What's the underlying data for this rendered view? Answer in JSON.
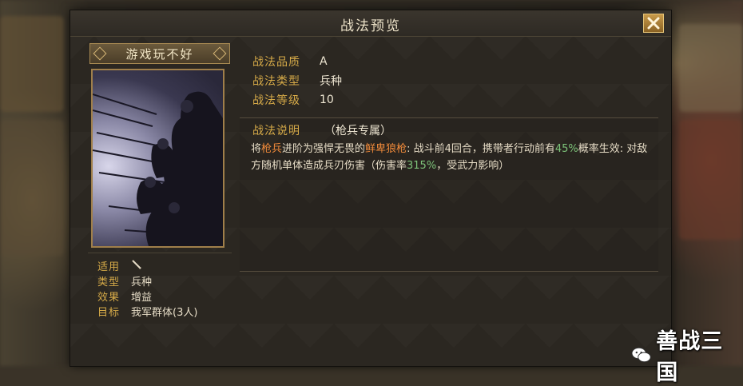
{
  "title": "战法预览",
  "skill_name": "游戏玩不好",
  "stats": [
    {
      "label": "适用",
      "value": "",
      "icon": "spear-icon"
    },
    {
      "label": "类型",
      "value": "兵种"
    },
    {
      "label": "效果",
      "value": "增益"
    },
    {
      "label": "目标",
      "value": "我军群体(3人)"
    }
  ],
  "info": [
    {
      "label": "战法品质",
      "value": "A"
    },
    {
      "label": "战法类型",
      "value": "兵种"
    },
    {
      "label": "战法等级",
      "value": "10"
    }
  ],
  "description": {
    "label": "战法说明",
    "tag": "（枪兵专属）",
    "segments": [
      {
        "text": "将",
        "style": "normal"
      },
      {
        "text": "枪兵",
        "style": "orange"
      },
      {
        "text": "进阶为强悍无畏的",
        "style": "normal"
      },
      {
        "text": "鲜卑狼枪",
        "style": "orange"
      },
      {
        "text": ": 战斗前4回合，携带者行动前有",
        "style": "normal"
      },
      {
        "text": "45%",
        "style": "green"
      },
      {
        "text": "概率生效: 对敌方随机单体造成兵刃伤害（伤害率",
        "style": "normal"
      },
      {
        "text": "315%",
        "style": "green"
      },
      {
        "text": "，受武力影响）",
        "style": "normal"
      }
    ]
  },
  "watermark": "善战三国",
  "colors": {
    "label_gold": "#d6aa48",
    "highlight_orange": "#f08a3a",
    "highlight_green": "#7ec47a"
  }
}
